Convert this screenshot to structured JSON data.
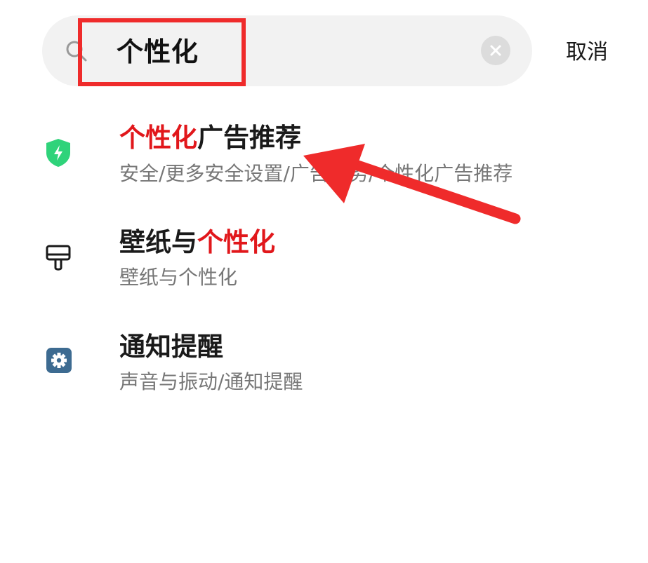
{
  "search": {
    "query": "个性化",
    "cancel_label": "取消"
  },
  "results": [
    {
      "icon": "shield-icon",
      "title_highlight": "个性化",
      "title_rest": "广告推荐",
      "path": "安全/更多安全设置/广告服务/个性化广告推荐"
    },
    {
      "icon": "paint-brush-icon",
      "title_prefix": "壁纸与",
      "title_highlight": "个性化",
      "path": "壁纸与个性化"
    },
    {
      "icon": "gear-icon",
      "title": "通知提醒",
      "path": "声音与振动/通知提醒"
    }
  ],
  "colors": {
    "highlight": "#e1171b",
    "annotation_red": "#ef2b2b",
    "shield_green": "#2fd37a",
    "gear_blue": "#3d6b91"
  }
}
